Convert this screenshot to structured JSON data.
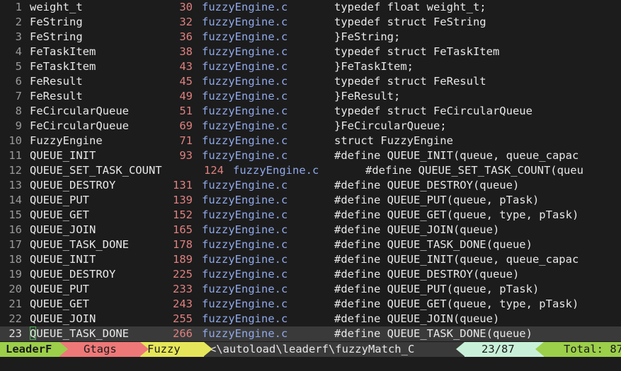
{
  "results": [
    {
      "num": "1",
      "tag": "weight_t",
      "line": "30",
      "file": "fuzzyEngine.c",
      "code": "typedef float weight_t;"
    },
    {
      "num": "2",
      "tag": "FeString",
      "line": "32",
      "file": "fuzzyEngine.c",
      "code": "typedef struct FeString"
    },
    {
      "num": "3",
      "tag": "FeString",
      "line": "36",
      "file": "fuzzyEngine.c",
      "code": "}FeString;"
    },
    {
      "num": "4",
      "tag": "FeTaskItem",
      "line": "38",
      "file": "fuzzyEngine.c",
      "code": "typedef struct FeTaskItem"
    },
    {
      "num": "5",
      "tag": "FeTaskItem",
      "line": "43",
      "file": "fuzzyEngine.c",
      "code": "}FeTaskItem;"
    },
    {
      "num": "6",
      "tag": "FeResult",
      "line": "45",
      "file": "fuzzyEngine.c",
      "code": "typedef struct FeResult"
    },
    {
      "num": "7",
      "tag": "FeResult",
      "line": "49",
      "file": "fuzzyEngine.c",
      "code": "}FeResult;"
    },
    {
      "num": "8",
      "tag": "FeCircularQueue",
      "line": "51",
      "file": "fuzzyEngine.c",
      "code": "typedef struct FeCircularQueue"
    },
    {
      "num": "9",
      "tag": "FeCircularQueue",
      "line": "69",
      "file": "fuzzyEngine.c",
      "code": "}FeCircularQueue;"
    },
    {
      "num": "10",
      "tag": "FuzzyEngine",
      "line": "71",
      "file": "fuzzyEngine.c",
      "code": "struct FuzzyEngine"
    },
    {
      "num": "11",
      "tag": "QUEUE_INIT",
      "line": "93",
      "file": "fuzzyEngine.c",
      "code": "#define QUEUE_INIT(queue, queue_capac"
    },
    {
      "num": "12",
      "tag": "QUEUE_SET_TASK_COUNT",
      "line": "124",
      "file": "fuzzyEngine.c",
      "code": "#define QUEUE_SET_TASK_COUNT(queu",
      "wide": true
    },
    {
      "num": "13",
      "tag": "QUEUE_DESTROY",
      "line": "131",
      "file": "fuzzyEngine.c",
      "code": "#define QUEUE_DESTROY(queue)"
    },
    {
      "num": "14",
      "tag": "QUEUE_PUT",
      "line": "139",
      "file": "fuzzyEngine.c",
      "code": "#define QUEUE_PUT(queue, pTask)"
    },
    {
      "num": "15",
      "tag": "QUEUE_GET",
      "line": "152",
      "file": "fuzzyEngine.c",
      "code": "#define QUEUE_GET(queue, type, pTask)"
    },
    {
      "num": "16",
      "tag": "QUEUE_JOIN",
      "line": "165",
      "file": "fuzzyEngine.c",
      "code": "#define QUEUE_JOIN(queue)"
    },
    {
      "num": "17",
      "tag": "QUEUE_TASK_DONE",
      "line": "178",
      "file": "fuzzyEngine.c",
      "code": "#define QUEUE_TASK_DONE(queue)"
    },
    {
      "num": "18",
      "tag": "QUEUE_INIT",
      "line": "189",
      "file": "fuzzyEngine.c",
      "code": "#define QUEUE_INIT(queue, queue_capac"
    },
    {
      "num": "19",
      "tag": "QUEUE_DESTROY",
      "line": "225",
      "file": "fuzzyEngine.c",
      "code": "#define QUEUE_DESTROY(queue)"
    },
    {
      "num": "20",
      "tag": "QUEUE_PUT",
      "line": "233",
      "file": "fuzzyEngine.c",
      "code": "#define QUEUE_PUT(queue, pTask)"
    },
    {
      "num": "21",
      "tag": "QUEUE_GET",
      "line": "243",
      "file": "fuzzyEngine.c",
      "code": "#define QUEUE_GET(queue, type, pTask)"
    },
    {
      "num": "22",
      "tag": "QUEUE_JOIN",
      "line": "255",
      "file": "fuzzyEngine.c",
      "code": "#define QUEUE_JOIN(queue)"
    },
    {
      "num": "23",
      "tag": "QUEUE_TASK_DONE",
      "line": "266",
      "file": "fuzzyEngine.c",
      "code": "#define QUEUE_TASK_DONE(queue)",
      "current": true
    }
  ],
  "statusline": {
    "mode": "LeaderF",
    "category": "Gtags",
    "match_mode": "Fuzzy",
    "cwd": "<\\autoload\\leaderf\\fuzzyMatch_C",
    "count": "23/87",
    "total": "Total: 87"
  },
  "colors": {
    "background": "#1c1c1c",
    "current_line": "#3a3a3a",
    "line_number": "#e08080",
    "file": "#8fa8e8",
    "mode_green": "#9ccf4a",
    "category_red": "#ee7878",
    "match_yellow": "#e6e65a",
    "count_mint": "#c8f0d8",
    "cursor_border": "#4caf50"
  }
}
